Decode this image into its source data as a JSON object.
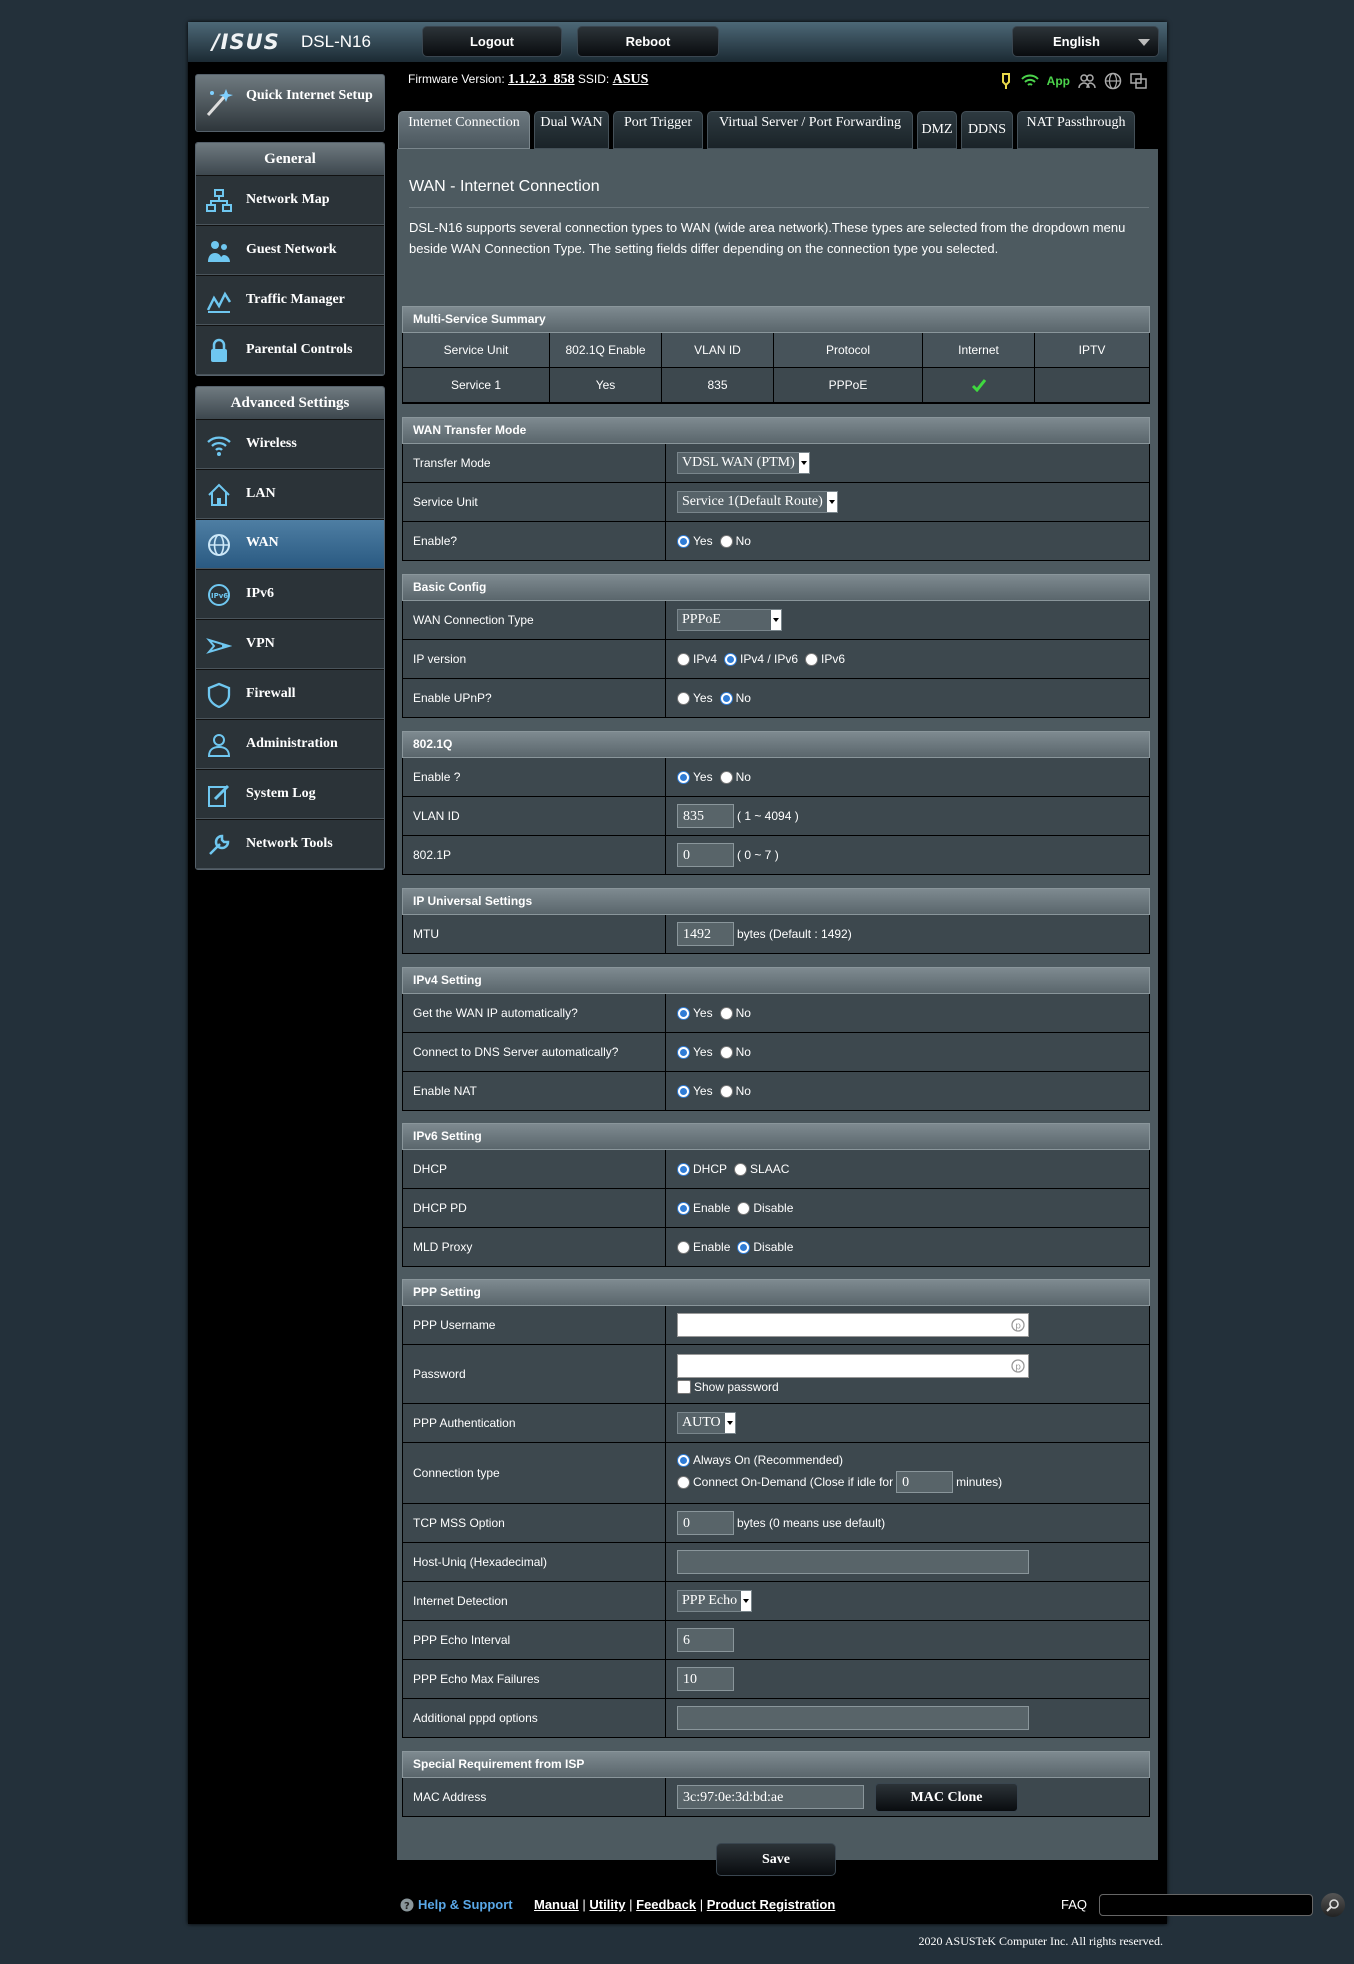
{
  "header": {
    "logo": "/ISUS",
    "model": "DSL-N16",
    "logout": "Logout",
    "reboot": "Reboot",
    "language": "English"
  },
  "status": {
    "fw_label": "Firmware Version:",
    "fw_value": "1.1.2.3_858",
    "ssid_label": "SSID:",
    "ssid_value": "ASUS",
    "app_label": "App"
  },
  "sidebar": {
    "qis": "Quick Internet Setup",
    "general_title": "General",
    "general": [
      {
        "label": "Network Map",
        "icon": "network-map-icon"
      },
      {
        "label": "Guest Network",
        "icon": "guest-network-icon"
      },
      {
        "label": "Traffic Manager",
        "icon": "traffic-manager-icon"
      },
      {
        "label": "Parental Controls",
        "icon": "parental-controls-icon"
      }
    ],
    "advanced_title": "Advanced Settings",
    "advanced": [
      {
        "label": "Wireless",
        "icon": "wireless-icon"
      },
      {
        "label": "LAN",
        "icon": "lan-icon"
      },
      {
        "label": "WAN",
        "icon": "wan-icon",
        "active": true
      },
      {
        "label": "IPv6",
        "icon": "ipv6-icon"
      },
      {
        "label": "VPN",
        "icon": "vpn-icon"
      },
      {
        "label": "Firewall",
        "icon": "firewall-icon"
      },
      {
        "label": "Administration",
        "icon": "administration-icon"
      },
      {
        "label": "System Log",
        "icon": "system-log-icon"
      },
      {
        "label": "Network Tools",
        "icon": "network-tools-icon"
      }
    ]
  },
  "tabs": [
    "Internet Connection",
    "Dual WAN",
    "Port Trigger",
    "Virtual Server / Port Forwarding",
    "DMZ",
    "DDNS",
    "NAT Passthrough"
  ],
  "page": {
    "title": "WAN - Internet Connection",
    "desc": "DSL-N16 supports several connection types to WAN (wide area network).These types are selected from the dropdown menu beside WAN Connection Type. The setting fields differ depending on the connection type you selected."
  },
  "summary": {
    "title": "Multi-Service Summary",
    "headers": [
      "Service Unit",
      "802.1Q Enable",
      "VLAN ID",
      "Protocol",
      "Internet",
      "IPTV"
    ],
    "row": [
      "Service 1",
      "Yes",
      "835",
      "PPPoE",
      "",
      ""
    ]
  },
  "transfer": {
    "title": "WAN Transfer Mode",
    "transfer_mode_label": "Transfer Mode",
    "transfer_mode_value": "VDSL WAN (PTM)",
    "service_unit_label": "Service Unit",
    "service_unit_value": "Service 1(Default Route)",
    "enable_label": "Enable?",
    "yes": "Yes",
    "no": "No"
  },
  "basic": {
    "title": "Basic Config",
    "conn_type_label": "WAN Connection Type",
    "conn_type_value": "PPPoE",
    "ipver_label": "IP version",
    "ipv4": "IPv4",
    "ipv4v6": "IPv4 / IPv6",
    "ipv6": "IPv6",
    "upnp_label": "Enable UPnP?",
    "yes": "Yes",
    "no": "No"
  },
  "dot1q": {
    "title": "802.1Q",
    "enable_label": "Enable ?",
    "vlan_label": "VLAN ID",
    "vlan_value": "835",
    "vlan_range": "( 1 ~ 4094 )",
    "p_label": "802.1P",
    "p_value": "0",
    "p_range": "( 0 ~ 7 )",
    "yes": "Yes",
    "no": "No"
  },
  "universal": {
    "title": "IP Universal Settings",
    "mtu_label": "MTU",
    "mtu_value": "1492",
    "mtu_note": "bytes (Default : 1492)"
  },
  "ipv4": {
    "title": "IPv4 Setting",
    "auto_ip_label": "Get the WAN IP automatically?",
    "dns_label": "Connect to DNS Server automatically?",
    "nat_label": "Enable NAT",
    "yes": "Yes",
    "no": "No"
  },
  "ipv6set": {
    "title": "IPv6 Setting",
    "dhcp_label": "DHCP",
    "dhcp": "DHCP",
    "slaac": "SLAAC",
    "pd_label": "DHCP PD",
    "enable": "Enable",
    "disable": "Disable",
    "mld_label": "MLD Proxy"
  },
  "ppp": {
    "title": "PPP Setting",
    "username_label": "PPP Username",
    "password_label": "Password",
    "show_password": "Show password",
    "auth_label": "PPP Authentication",
    "auth_value": "AUTO",
    "conntype_label": "Connection type",
    "always_on": "Always On (Recommended)",
    "on_demand": "Connect On-Demand (Close if idle for",
    "idle_value": "0",
    "minutes": "minutes)",
    "mss_label": "TCP MSS Option",
    "mss_value": "0",
    "mss_note": "bytes (0 means use default)",
    "hostuniq_label": "Host-Uniq (Hexadecimal)",
    "detect_label": "Internet Detection",
    "detect_value": "PPP Echo",
    "echo_int_label": "PPP Echo Interval",
    "echo_int_value": "6",
    "echo_max_label": "PPP Echo Max Failures",
    "echo_max_value": "10",
    "pppd_label": "Additional pppd options"
  },
  "isp": {
    "title": "Special Requirement from ISP",
    "mac_label": "MAC Address",
    "mac_value": "3c:97:0e:3d:bd:ae",
    "clone": "MAC Clone"
  },
  "save": "Save",
  "footer": {
    "help": "Help & Support",
    "manual": "Manual",
    "utility": "Utility",
    "feedback": "Feedback",
    "registration": "Product Registration",
    "faq": "FAQ"
  },
  "copyright": "2020 ASUSTeK Computer Inc. All rights reserved."
}
